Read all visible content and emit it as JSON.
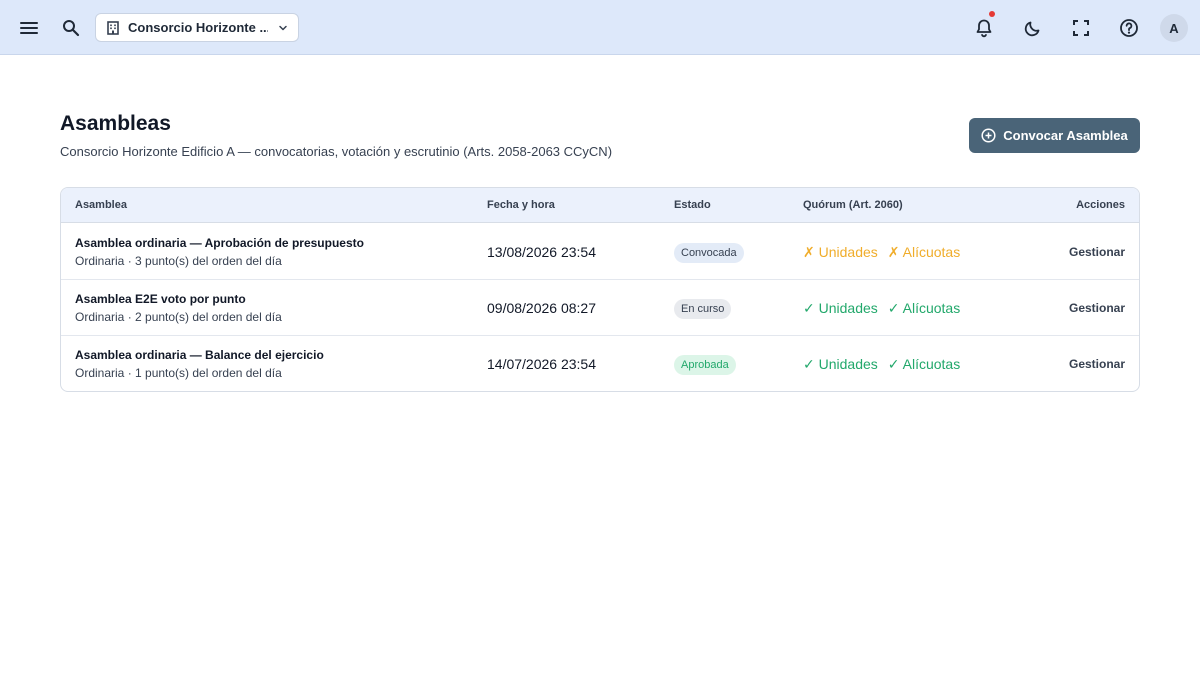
{
  "topbar": {
    "org_name": "Consorcio Horizonte ...",
    "avatar_initial": "A",
    "notification_dot_color": "#e53935"
  },
  "header": {
    "title": "Asambleas",
    "subtitle": "Consorcio Horizonte Edificio A — convocatorias, votación y escrutinio (Arts. 2058-2063 CCyCN)",
    "primary_button": "Convocar Asamblea"
  },
  "table": {
    "columns": [
      "Asamblea",
      "Fecha y hora",
      "Estado",
      "Quórum (Art. 2060)",
      "Acciones"
    ],
    "rows": [
      {
        "title": "Asamblea ordinaria — Aprobación de presupuesto",
        "subtitle": "Ordinaria · 3 punto(s) del orden del día",
        "datetime": "13/08/2026 23:54",
        "status": "Convocada",
        "quorum_units": "✗ Unidades",
        "quorum_aliquots": "✗ Alícuotas",
        "quorum_met": false,
        "action": "Gestionar"
      },
      {
        "title": "Asamblea E2E voto por punto",
        "subtitle": "Ordinaria · 2 punto(s) del orden del día",
        "datetime": "09/08/2026 08:27",
        "status": "En curso",
        "quorum_units": "✓ Unidades",
        "quorum_aliquots": "✓ Alícuotas",
        "quorum_met": true,
        "action": "Gestionar"
      },
      {
        "title": "Asamblea ordinaria — Balance del ejercicio",
        "subtitle": "Ordinaria · 1 punto(s) del orden del día",
        "datetime": "14/07/2026 23:54",
        "status": "Aprobada",
        "quorum_units": "✓ Unidades",
        "quorum_aliquots": "✓ Alícuotas",
        "quorum_met": true,
        "action": "Gestionar"
      }
    ]
  },
  "colors": {
    "topbar_bg": "#dde8fa",
    "primary": "#4a6478",
    "quorum_ok": "#22a86b",
    "quorum_fail": "#f0ad2b",
    "badge_convocada_bg": "#e3ebf7",
    "badge_encurso_bg": "#e8eaee",
    "badge_aprobada_bg": "#dcf5e8",
    "badge_aprobada_text": "#22a86b"
  }
}
